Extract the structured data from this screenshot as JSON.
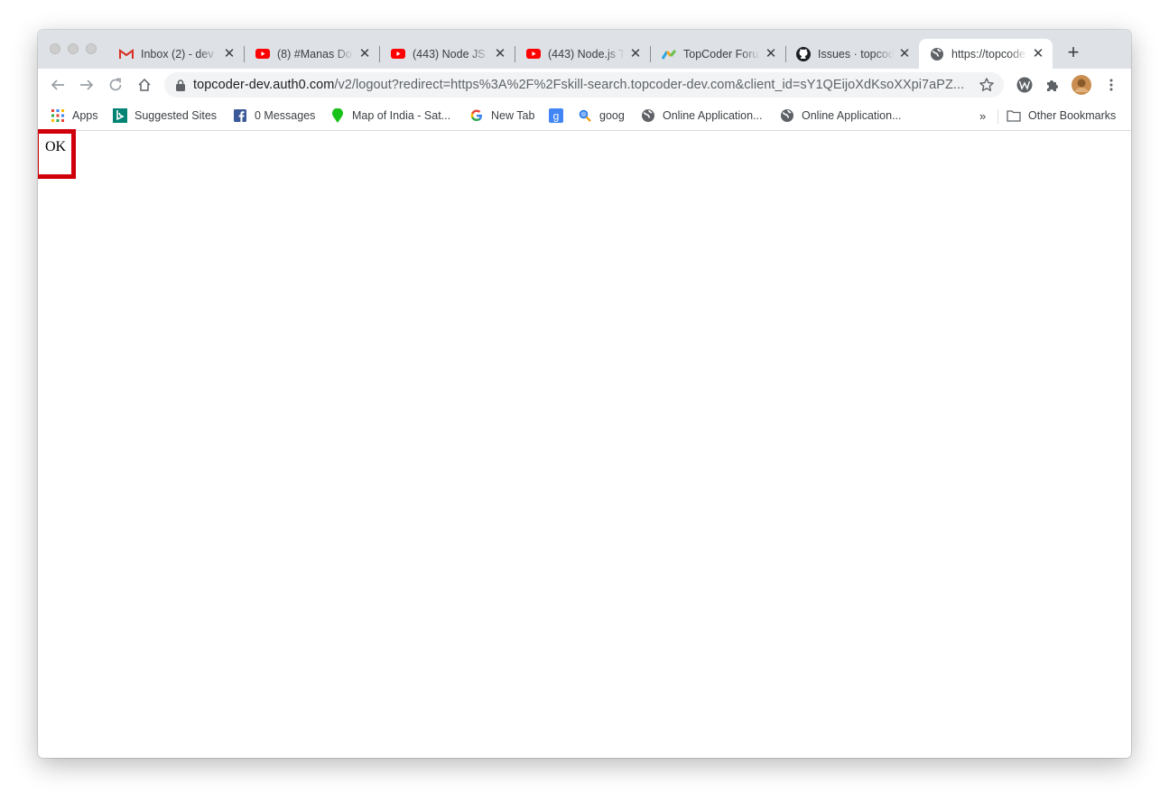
{
  "tabs": [
    {
      "title": "Inbox (2) - dev",
      "icon": "gmail-icon",
      "active": false
    },
    {
      "title": "(8) #Manas Do",
      "icon": "youtube-icon",
      "active": false
    },
    {
      "title": "(443) Node JS",
      "icon": "youtube-icon",
      "active": false
    },
    {
      "title": "(443) Node.js T",
      "icon": "youtube-icon",
      "active": false
    },
    {
      "title": "TopCoder Foru",
      "icon": "topcoder-icon",
      "active": false
    },
    {
      "title": "Issues · topcod",
      "icon": "github-icon",
      "active": false
    },
    {
      "title": "https://topcode",
      "icon": "globe-icon",
      "active": true
    }
  ],
  "toolbar": {
    "url_host": "topcoder-dev.auth0.com",
    "url_path": "/v2/logout?redirect=https%3A%2F%2Fskill-search.topcoder-dev.com&client_id=sY1QEijoXdKsoXXpi7aPZ..."
  },
  "bookmarks": [
    {
      "label": "Apps",
      "icon": "apps-grid-icon"
    },
    {
      "label": "Suggested Sites",
      "icon": "bing-icon"
    },
    {
      "label": "0 Messages",
      "icon": "facebook-icon"
    },
    {
      "label": "Map of India - Sat...",
      "icon": "map-pin-icon"
    },
    {
      "label": "New Tab",
      "icon": "google-icon"
    },
    {
      "label": "",
      "icon": "google-bookmark-icon"
    },
    {
      "label": "goog",
      "icon": "magnifier-icon"
    },
    {
      "label": "Online Application...",
      "icon": "globe-icon"
    },
    {
      "label": "Online Application...",
      "icon": "globe-icon"
    }
  ],
  "bookmarks_more": "»",
  "other_bookmarks": "Other Bookmarks",
  "page": {
    "ok_text": "OK"
  },
  "colors": {
    "highlight_border": "#d0000b",
    "tabstrip_bg": "#dee1e6",
    "omnibox_bg": "#f1f3f4"
  }
}
